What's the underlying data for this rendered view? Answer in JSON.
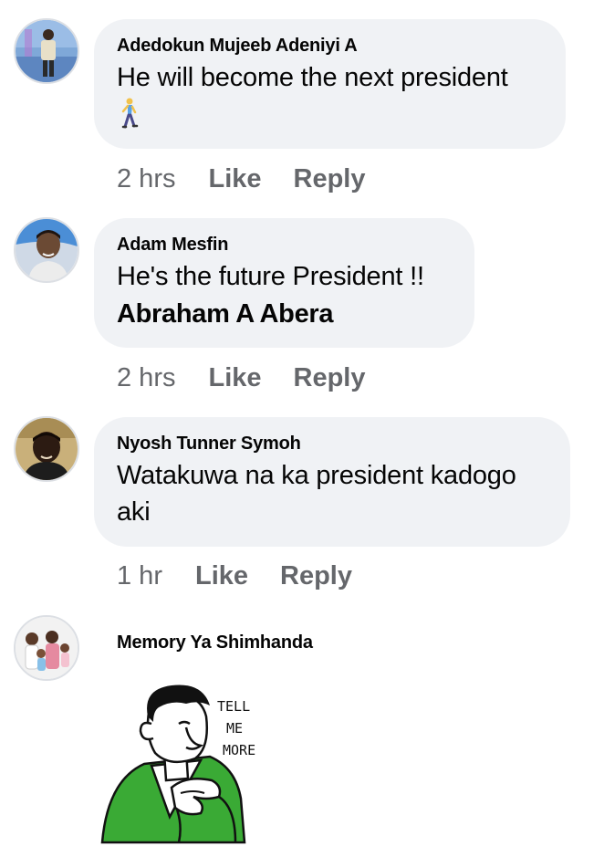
{
  "comments": [
    {
      "author": "Adedokun Mujeeb Adeniyi A",
      "text": "He will become the next president",
      "emoji": "🚶",
      "time": "2 hrs",
      "like": "Like",
      "reply": "Reply"
    },
    {
      "author": "Adam Mesfin",
      "text": "He's the future President !!",
      "mention": "Abraham A Abera",
      "time": "2 hrs",
      "like": "Like",
      "reply": "Reply"
    },
    {
      "author": "Nyosh Tunner Symoh",
      "text_line1": "Watakuwa na ka president kadogo",
      "text_line2": "aki",
      "time": "1 hr",
      "like": "Like",
      "reply": "Reply"
    },
    {
      "author": "Memory Ya Shimhanda",
      "sticker_text": [
        "TELL",
        "ME",
        "MORE"
      ]
    }
  ],
  "colors": {
    "bubble": "#f0f2f5",
    "meta": "#65676b",
    "text": "#050505",
    "sticker_green": "#3aaa35"
  }
}
